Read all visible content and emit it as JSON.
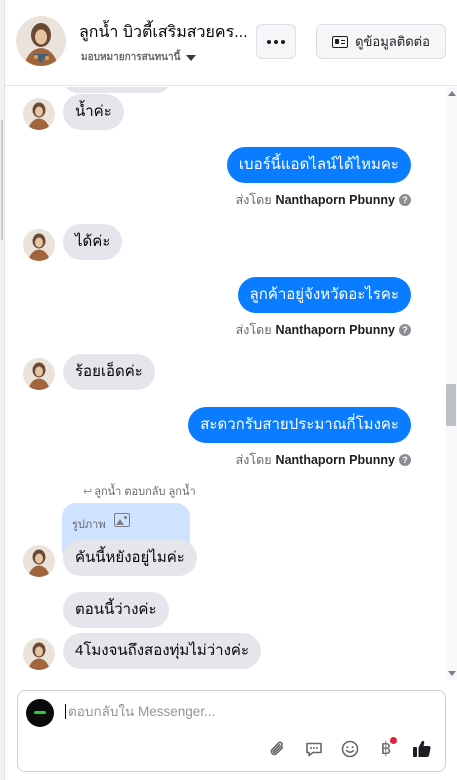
{
  "header": {
    "page_name": "ลูกน้ำ บิวตี้เสริมสวยคร...",
    "assignee_label": "มอบหมายการสนทนานี้",
    "more_label": "More options",
    "contact_button_label": "ดูข้อมูลติดต่อ"
  },
  "conversation": {
    "messages": [
      {
        "direction": "in",
        "text": "น้ำค่ะ"
      },
      {
        "direction": "out",
        "text": "เบอร์นี้แอดไลน์ได้ไหมคะ",
        "sent_by_prefix": "ส่งโดย",
        "sent_by_name": "Nanthaporn Pbunny"
      },
      {
        "direction": "in",
        "text": "ได้ค่ะ"
      },
      {
        "direction": "out",
        "text": "ลูกค้าอยู่จังหวัดอะไรคะ",
        "sent_by_prefix": "ส่งโดย",
        "sent_by_name": "Nanthaporn Pbunny"
      },
      {
        "direction": "in",
        "text": "ร้อยเอ็ดค่ะ"
      },
      {
        "direction": "out",
        "text": "สะดวกรับสายประมาณกี่โมงคะ",
        "sent_by_prefix": "ส่งโดย",
        "sent_by_name": "Nanthaporn Pbunny"
      },
      {
        "direction": "in",
        "text": "คันนี้หยังอยู่ไมค่ะ"
      },
      {
        "direction": "in",
        "text": "ตอนนี้ว่างค่ะ"
      },
      {
        "direction": "in",
        "text": "4โมงจนถึงสองทุ่มไม่ว่างค่ะ"
      }
    ],
    "reply_note": "ลูกน้ำ ตอบกลับ ลูกน้ำ",
    "quoted_label": "รูปภาพ",
    "help_glyph": "?"
  },
  "composer": {
    "placeholder": "ตอบกลับใน Messenger...",
    "baht_symbol": "฿"
  },
  "colors": {
    "outgoing_bubble": "#0a7cff",
    "incoming_bubble": "#e4e6eb",
    "quoted_bubble": "#cfe2ff",
    "notification_dot": "#e41e3f"
  },
  "icons": [
    "caret-down-icon",
    "more-dots-icon",
    "contact-card-icon",
    "help-icon",
    "reply-arrow-icon",
    "photo-icon",
    "attach-icon",
    "saved-reply-icon",
    "emoji-icon",
    "baht-icon",
    "thumbs-up-icon"
  ]
}
